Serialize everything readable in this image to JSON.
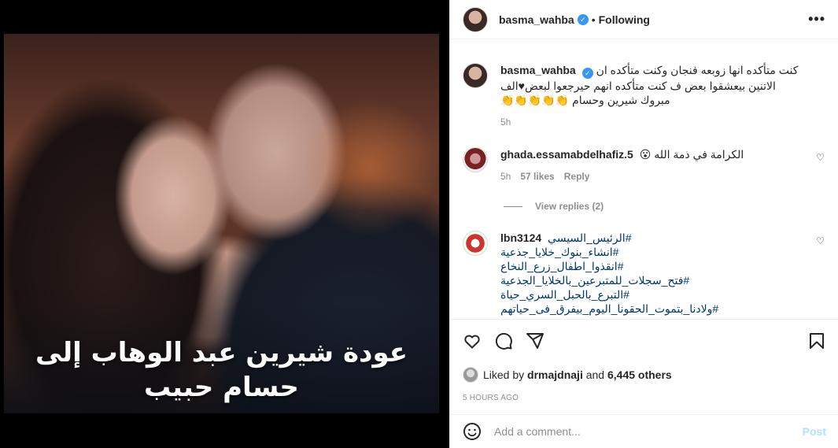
{
  "media": {
    "overlay_line1": "عودة شيرين عبد الوهاب إلى",
    "overlay_line2": "حسام حبيب"
  },
  "header": {
    "username": "basma_wahba",
    "separator": "•",
    "follow_status": "Following",
    "more_label": "•••"
  },
  "caption": {
    "username": "basma_wahba",
    "text": "كنت متأكده انها زوبعه فنجان وكنت متأكده ان الاتنين بيعشقوا بعض ف كنت متأكده انهم حيرجعوا لبعض♥الف مبروك شيرين وحسام 👏👏👏👏👏",
    "time": "5h"
  },
  "comments": [
    {
      "username": "ghada.essamabdelhafiz.5",
      "text": "الكرامة في ذمة الله 😮",
      "time": "5h",
      "likes": "57 likes",
      "reply": "Reply",
      "view_replies": "View replies (2)"
    },
    {
      "username": "lbn3124",
      "hashtags": [
        "#الرئيس_السيسي",
        "#انشاء_بنوك_خلايا_جذعية",
        "#انقذوا_اطفال_زرع_النخاع",
        "#فتح_سجلات_للمتبرعين_بالخلايا_الجذعية",
        "#التبرع_بالحبل_السري_حياة",
        "#ولادنا_بتموت_الحقونا_اليوم_بيفرق_فى_حياتهم"
      ]
    }
  ],
  "likes": {
    "prefix": "Liked by",
    "user": "drmajdnaji",
    "conj": "and",
    "others": "6,445 others"
  },
  "time_ago": "5 HOURS AGO",
  "add_comment": {
    "placeholder": "Add a comment...",
    "post_label": "Post"
  },
  "icons": [
    "verified-badge-icon",
    "heart-icon",
    "comment-icon",
    "share-icon",
    "save-icon",
    "emoji-icon"
  ],
  "colors": {
    "link": "#00376b",
    "verified": "#3897f0",
    "post_disabled": "#b2dffc",
    "muted": "#8e8e8e"
  }
}
